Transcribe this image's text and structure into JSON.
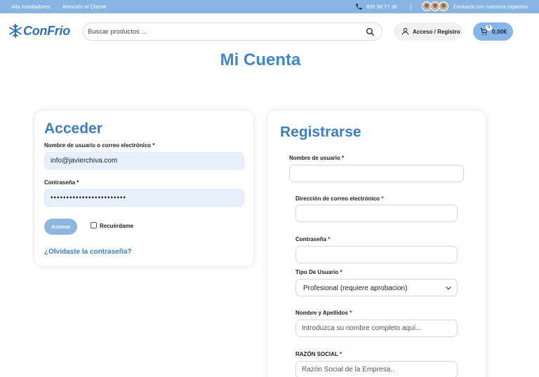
{
  "topbar": {
    "links": [
      "Alta Instaladores",
      "Atención al Cliente"
    ],
    "phone": "656 56 77 36",
    "experts": "Contacta con nuestros expertos"
  },
  "header": {
    "logo": "ConFrio",
    "search_placeholder": "Buscar productos ...",
    "account_label": "Acceso / Registro",
    "cart_count": "0",
    "cart_total": "0,00€"
  },
  "page_title": "Mi Cuenta",
  "login": {
    "title": "Acceder",
    "username_label": "Nombre de usuario o correo electrónico",
    "username_value": "info@javierchiva.com",
    "password_label": "Contraseña",
    "password_value": "••••••••••••••••••••••••",
    "submit_label": "Acceso",
    "remember_label": "Recuérdame",
    "forgot_label": "¿Olvidaste la contraseña?"
  },
  "register": {
    "title": "Registrarse",
    "username_label": "Nombre de usuario",
    "email_label": "Dirección de correo electrónico",
    "password_label": "Contraseña",
    "user_type_label": "Tipo De Usuario",
    "user_type_value": "Profesional (requiere aprobacion)",
    "fullname_label": "Nombre y Apellidos",
    "fullname_placeholder": "Introduzca su nombre completo aquí...",
    "company_label": "RAZÓN SOCIAL",
    "company_placeholder": "Razón Social de la Empresa.."
  },
  "required_mark": "*",
  "colors": {
    "accent": "#3f86cf",
    "topbar": "#86b5e4",
    "required": "#d0021b"
  }
}
